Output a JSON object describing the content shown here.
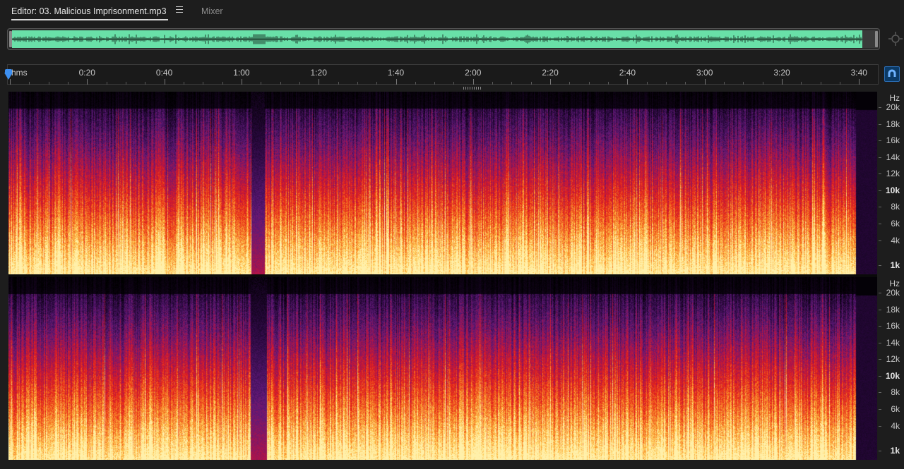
{
  "tabs": {
    "editor_label": "Editor: 03. Malicious Imprisonment.mp3",
    "mixer_label": "Mixer"
  },
  "timeline": {
    "unit_label": "hms",
    "ticks": [
      "0:20",
      "0:40",
      "1:00",
      "1:20",
      "1:40",
      "2:00",
      "2:20",
      "2:40",
      "3:00",
      "3:20",
      "3:40"
    ]
  },
  "frequency_scale": {
    "unit_label": "Hz",
    "labels": [
      "20k",
      "18k",
      "16k",
      "14k",
      "12k",
      "10k",
      "8k",
      "6k",
      "4k",
      "1k"
    ],
    "bold": [
      "10k",
      "1k"
    ]
  },
  "colors": {
    "overview_wave": "#69e0a8",
    "accent": "#3d8ff0",
    "spectrum_low": "#ffe08a",
    "spectrum_mid": "#e8221f",
    "spectrum_high": "#5a1a78"
  },
  "icons": {
    "tab_menu": "hamburger-menu-icon",
    "zoom": "zoom-navigator-icon",
    "snap": "magnet-icon",
    "playhead": "playhead-marker-icon"
  }
}
